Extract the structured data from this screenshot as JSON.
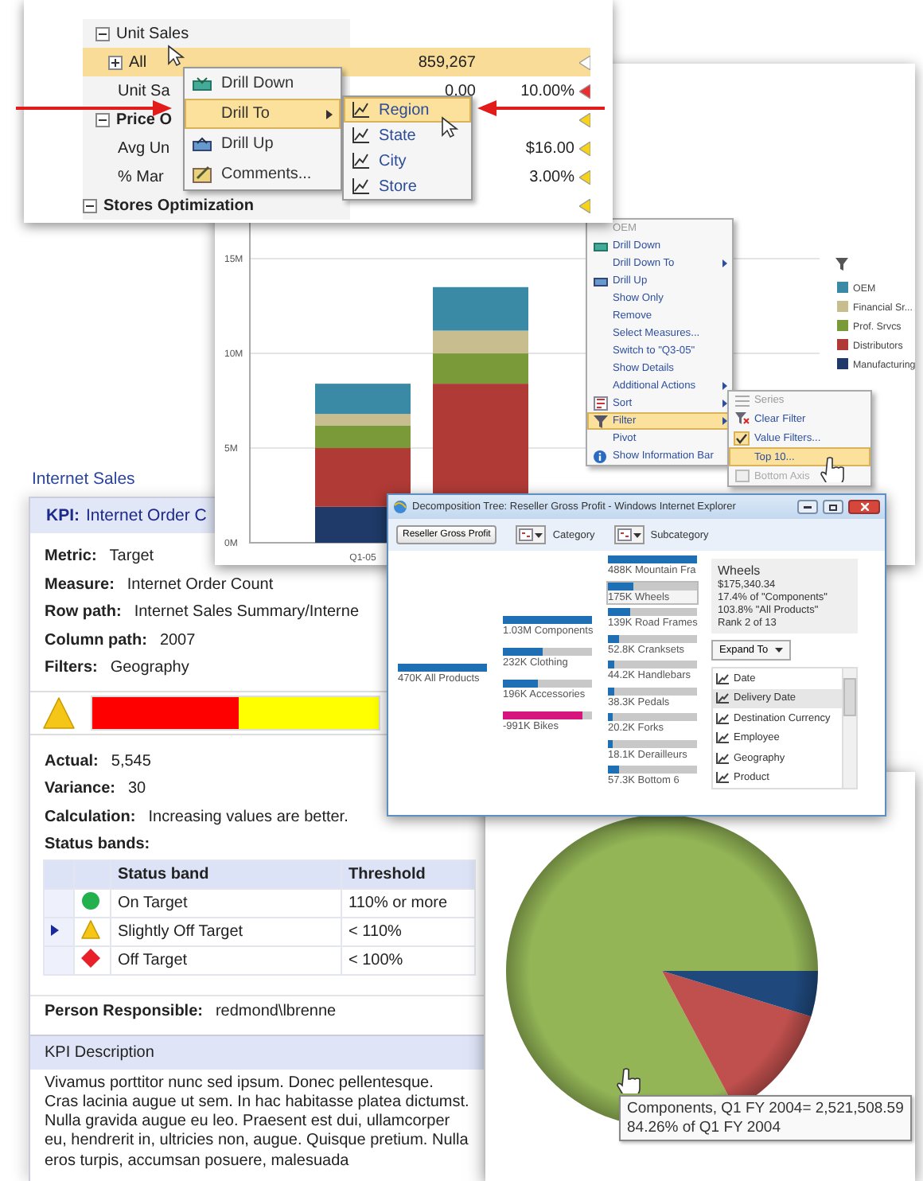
{
  "grid_window": {
    "rows": [
      {
        "kind": "group",
        "label": "Unit Sales",
        "expanded": true,
        "selected": false
      },
      {
        "kind": "member",
        "label": "All",
        "expanded": false,
        "selected": true,
        "column_2": "859,267",
        "color": "#ffffff"
      },
      {
        "kind": "measure",
        "label": "Unit Sa",
        "selected": false,
        "column_2": "0.00",
        "column_3": "10.00%",
        "color": "#e8312f"
      },
      {
        "kind": "section",
        "label": "Price O",
        "expanded": true,
        "selected": false,
        "color": "#f7d21a"
      },
      {
        "kind": "measure",
        "label": "Avg Un",
        "selected": false,
        "column_3": "$16.00",
        "color": "#f7d21a"
      },
      {
        "kind": "measure",
        "label": "% Mar",
        "selected": false,
        "column_3": "3.00%",
        "color": "#f7d21a"
      },
      {
        "kind": "section",
        "label": "Stores Optimization",
        "expanded": true,
        "selected": false,
        "color": "#f7d21a"
      }
    ],
    "context_menu": [
      {
        "kind": "down",
        "label": "Drill Down",
        "selected": false,
        "submenu": false
      },
      {
        "kind": "plain",
        "label": "Drill To",
        "selected": true,
        "submenu": true
      },
      {
        "kind": "up",
        "label": "Drill Up",
        "selected": false,
        "submenu": false
      },
      {
        "kind": "note",
        "label": "Comments...",
        "selected": false,
        "submenu": false
      }
    ],
    "submenu": [
      {
        "label": "Region",
        "selected": true
      },
      {
        "label": "State",
        "selected": false
      },
      {
        "label": "City",
        "selected": false
      },
      {
        "label": "Store",
        "selected": false
      }
    ]
  },
  "chart_window": {
    "chart_data": {
      "type": "bar",
      "stacked": true,
      "categories": [
        "Q1-05",
        null,
        null,
        null
      ],
      "ylim": [
        0,
        25.3
      ],
      "legend": "right",
      "grid": true,
      "yticks": [
        {
          "value": 0,
          "label": "0M"
        },
        {
          "value": 5,
          "label": "5M"
        },
        {
          "value": 10,
          "label": "10M"
        },
        {
          "value": 15,
          "label": "15M"
        }
      ],
      "series": [
        {
          "name": "Manufacturing",
          "color": "#1f3a68",
          "values": [
            1.9,
            null,
            null,
            null
          ]
        },
        {
          "name": "Distributors",
          "color": "#b03a36",
          "values": [
            3.1,
            8.4,
            null,
            null
          ]
        },
        {
          "name": "Prof. Srvcs",
          "color": "#7a9a3a",
          "values": [
            1.2,
            1.6,
            null,
            null
          ]
        },
        {
          "name": "Financial Sr...",
          "color": "#c8bd8f",
          "values": [
            0.6,
            1.2,
            null,
            null
          ]
        },
        {
          "name": "OEM",
          "color": "#3a8aa6",
          "values": [
            1.6,
            2.3,
            null,
            null
          ]
        }
      ]
    },
    "context_menu": {
      "header": "OEM",
      "items": [
        {
          "kind": "down",
          "label": "Drill Down",
          "selected": false,
          "submenu": false
        },
        {
          "kind": "plain",
          "label": "Drill Down To",
          "selected": false,
          "submenu": true
        },
        {
          "kind": "up",
          "label": "Drill Up",
          "selected": false,
          "submenu": false
        },
        {
          "kind": "plain",
          "label": "Show Only",
          "selected": false,
          "submenu": false
        },
        {
          "kind": "plain",
          "label": "Remove",
          "selected": false,
          "submenu": false
        },
        {
          "kind": "plain",
          "label": "Select Measures...",
          "selected": false,
          "submenu": false
        },
        {
          "kind": "plain",
          "label": "Switch to \"Q3-05\"",
          "selected": false,
          "submenu": false
        },
        {
          "kind": "plain",
          "label": "Show Details",
          "selected": false,
          "submenu": false
        },
        {
          "kind": "plain",
          "label": "Additional Actions",
          "selected": false,
          "submenu": true
        },
        {
          "kind": "sort",
          "label": "Sort",
          "selected": false,
          "submenu": true
        },
        {
          "kind": "filter",
          "label": "Filter",
          "selected": true,
          "submenu": true
        },
        {
          "kind": "plain",
          "label": "Pivot",
          "selected": false,
          "submenu": false
        },
        {
          "kind": "info",
          "label": "Show Information Bar",
          "selected": false,
          "submenu": false
        }
      ]
    },
    "submenu": {
      "header": "Series",
      "items": [
        {
          "kind": "clear",
          "label": "Clear Filter",
          "selected": false,
          "checked": false,
          "disabled": false
        },
        {
          "kind": "plain",
          "label": "Value Filters...",
          "selected": false,
          "checked": true,
          "disabled": false
        },
        {
          "kind": "plain",
          "label": "Top 10...",
          "selected": true,
          "checked": false,
          "disabled": false
        },
        {
          "kind": "axis",
          "label": "Bottom Axis",
          "selected": false,
          "checked": false,
          "disabled": true
        }
      ]
    }
  },
  "kpi_panel": {
    "breadcrumb": "Internet Sales",
    "heading_label": "KPI:",
    "heading": "Internet Order C",
    "properties": [
      {
        "label": "Metric:",
        "value": "Target"
      },
      {
        "label": "Measure:",
        "value": "Internet Order Count"
      },
      {
        "label": "Row path:",
        "value": "Internet Sales Summary/Interne"
      },
      {
        "label": "Column path:",
        "value": "2007"
      },
      {
        "label": "Filters:",
        "value": "Geography"
      }
    ],
    "indicator": {
      "kind": "triangle",
      "color": "#f5c518"
    },
    "gauge": [
      {
        "color": "#ff0000",
        "level": 0.51
      },
      {
        "color": "#ffff00",
        "level": 0.49
      }
    ],
    "results": [
      {
        "label": "Actual:",
        "value": "5,545"
      },
      {
        "label": "Variance:",
        "value": "30"
      },
      {
        "label": "Calculation:",
        "value": "Increasing values are better."
      }
    ],
    "status_bands_label": "Status bands:",
    "bands_table": {
      "columns": [
        "Status band",
        "Threshold"
      ],
      "rows": [
        {
          "kind": "circle",
          "color": "#22b14c",
          "band": "On Target",
          "threshold": "110% or more",
          "selected": false
        },
        {
          "kind": "triangle",
          "color": "#f5c518",
          "band": "Slightly Off Target",
          "threshold": "< 110%",
          "selected": true
        },
        {
          "kind": "diamond",
          "color": "#e8202a",
          "band": "Off Target",
          "threshold": "< 100%",
          "selected": false
        }
      ]
    },
    "person": {
      "label": "Person Responsible:",
      "value": "redmond\\lbrenne"
    },
    "description_heading": "KPI Description",
    "description": "Vivamus porttitor nunc sed ipsum. Donec pellentesque. Cras lacinia augue ut sem. In hac habitasse platea dictumst. Nulla gravida augue eu leo. Praesent est dui, ullamcorper eu, hendrerit in, ultricies non, augue. Quisque pretium. Nulla eros turpis, accumsan posuere, malesuada"
  },
  "decomposition_window": {
    "title": "Decomposition Tree: Reseller Gross Profit - Windows Internet Explorer",
    "measure_button": "Reseller Gross Profit",
    "levels": [
      "Category",
      "Subcategory"
    ],
    "columns": [
      [
        {
          "label": "470K All Products",
          "level": 1,
          "selected": false,
          "color": "#1f6fb5"
        }
      ],
      [
        {
          "label": "1.03M Components",
          "level": 1,
          "selected": false,
          "color": "#1f6fb5"
        },
        {
          "label": "232K Clothing",
          "level": 0.45,
          "selected": false,
          "color": "#1f6fb5"
        },
        {
          "label": "196K Accessories",
          "level": 0.4,
          "selected": false,
          "color": "#1f6fb5"
        },
        {
          "label": "-991K Bikes",
          "level": 0.9,
          "selected": false,
          "color": "#d6157f"
        }
      ],
      [
        {
          "label": "488K Mountain Fra",
          "level": 1,
          "selected": false,
          "color": "#1f6fb5"
        },
        {
          "label": "175K Wheels",
          "level": 0.28,
          "selected": true,
          "color": "#1f6fb5"
        },
        {
          "label": "139K Road Frames",
          "level": 0.25,
          "selected": false,
          "color": "#1f6fb5"
        },
        {
          "label": "52.8K Cranksets",
          "level": 0.12,
          "selected": false,
          "color": "#1f6fb5"
        },
        {
          "label": "44.2K Handlebars",
          "level": 0.08,
          "selected": false,
          "color": "#1f6fb5"
        },
        {
          "label": "38.3K Pedals",
          "level": 0.08,
          "selected": false,
          "color": "#1f6fb5"
        },
        {
          "label": "20.2K Forks",
          "level": 0.06,
          "selected": false,
          "color": "#1f6fb5"
        },
        {
          "label": "18.1K Derailleurs",
          "level": 0.06,
          "selected": false,
          "color": "#1f6fb5"
        },
        {
          "label": "57.3K Bottom 6",
          "level": 0.12,
          "selected": false,
          "color": "#1f6fb5"
        }
      ]
    ],
    "details": {
      "title": "Wheels",
      "lines": [
        "$175,340.34",
        "17.4% of \"Components\"",
        "103.8% \"All Products\"",
        "Rank 2 of 13"
      ]
    },
    "expand_button": "Expand To",
    "fields": [
      {
        "label": "Date",
        "selected": false
      },
      {
        "label": "Delivery Date",
        "selected": true
      },
      {
        "label": "Destination Currency",
        "selected": false
      },
      {
        "label": "Employee",
        "selected": false
      },
      {
        "label": "Geography",
        "selected": false
      },
      {
        "label": "Product",
        "selected": false
      }
    ]
  },
  "pie_window": {
    "tooltip": [
      "Components, Q1 FY 2004= 2,521,508.59",
      "84.26% of Q1 FY 2004"
    ]
  }
}
